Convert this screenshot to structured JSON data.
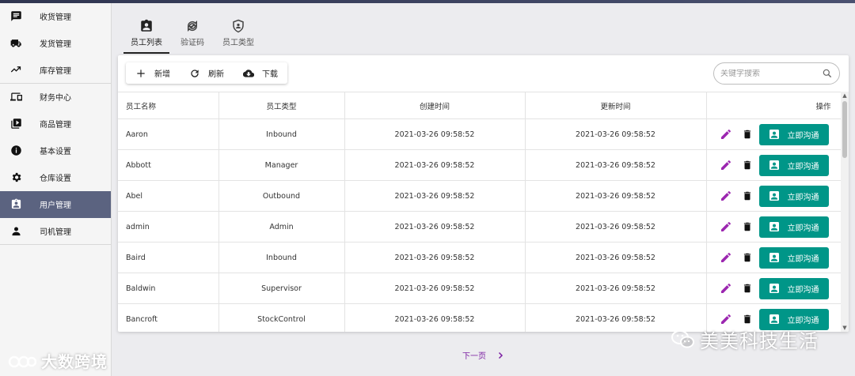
{
  "sidebar": {
    "items": [
      {
        "label": "收货管理",
        "icon": "chat-icon"
      },
      {
        "label": "发货管理",
        "icon": "truck-icon"
      },
      {
        "label": "库存管理",
        "icon": "trend-icon"
      },
      {
        "label": "财务中心",
        "icon": "devices-icon"
      },
      {
        "label": "商品管理",
        "icon": "video-library-icon"
      },
      {
        "label": "基本设置",
        "icon": "info-icon"
      },
      {
        "label": "仓库设置",
        "icon": "gear-icon"
      },
      {
        "label": "用户管理",
        "icon": "badge-icon",
        "active": true
      },
      {
        "label": "司机管理",
        "icon": "person-icon"
      }
    ]
  },
  "tabs": [
    {
      "label": "员工列表",
      "active": true
    },
    {
      "label": "验证码"
    },
    {
      "label": "员工类型"
    }
  ],
  "toolbar": {
    "add_label": "新增",
    "refresh_label": "刷新",
    "download_label": "下载"
  },
  "search": {
    "placeholder": "关键字搜索"
  },
  "table": {
    "headers": [
      "员工名称",
      "员工类型",
      "创建时间",
      "更新时间",
      "操作"
    ],
    "rows": [
      {
        "name": "Aaron",
        "type": "Inbound",
        "created": "2021-03-26 09:58:52",
        "updated": "2021-03-26 09:58:52"
      },
      {
        "name": "Abbott",
        "type": "Manager",
        "created": "2021-03-26 09:58:52",
        "updated": "2021-03-26 09:58:52"
      },
      {
        "name": "Abel",
        "type": "Outbound",
        "created": "2021-03-26 09:58:52",
        "updated": "2021-03-26 09:58:52"
      },
      {
        "name": "admin",
        "type": "Admin",
        "created": "2021-03-26 09:58:52",
        "updated": "2021-03-26 09:58:52"
      },
      {
        "name": "Baird",
        "type": "Inbound",
        "created": "2021-03-26 09:58:52",
        "updated": "2021-03-26 09:58:52"
      },
      {
        "name": "Baldwin",
        "type": "Supervisor",
        "created": "2021-03-26 09:58:52",
        "updated": "2021-03-26 09:58:52"
      },
      {
        "name": "Bancroft",
        "type": "StockControl",
        "created": "2021-03-26 09:58:52",
        "updated": "2021-03-26 09:58:52"
      }
    ],
    "chat_label": "立即沟通"
  },
  "pager": {
    "next_label": "下一页"
  },
  "watermarks": {
    "left": "大数跨境",
    "right": "美美科技生活"
  },
  "colors": {
    "accent": "#009688",
    "active_nav": "#5b6380",
    "edit": "#9c27b0",
    "pager": "#7b1fa2"
  }
}
